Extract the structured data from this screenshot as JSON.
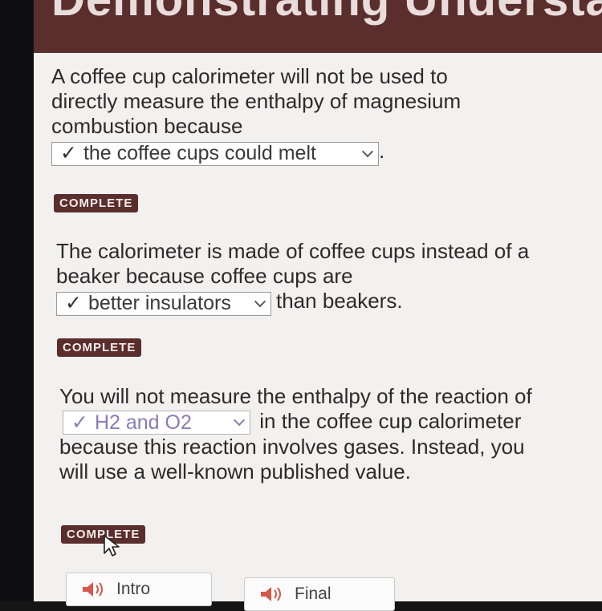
{
  "header": {
    "title": "Demonstrating Understanding"
  },
  "questions": [
    {
      "text_before": "A coffee cup calorimeter will not be used to directly measure the enthalpy of magnesium combustion because",
      "answer": "the coffee cups could melt",
      "text_after": ".",
      "status": "COMPLETE"
    },
    {
      "text_before": "The calorimeter is made of coffee cups instead of a beaker because coffee cups are",
      "answer": "better insulators",
      "text_after": "than beakers.",
      "status": "COMPLETE"
    },
    {
      "text_before": "You will not measure the enthalpy of the reaction of",
      "answer": "H2 and O2",
      "text_after": "in the coffee cup calorimeter because this reaction involves gases. Instead, you will use a well-known published value.",
      "status": "COMPLETE"
    }
  ],
  "check_glyph": "✓",
  "buttons": {
    "intro": "Intro",
    "final": "Final"
  },
  "colors": {
    "header": "#5a2e2c",
    "badge": "#5a2e2c",
    "panel": "#f2f1ef",
    "dropdown_purple": "#8a7bb4"
  },
  "icons": {
    "dropdown": "chevron-down-icon",
    "audio": "speaker-icon",
    "pointer": "mouse-cursor-icon"
  }
}
